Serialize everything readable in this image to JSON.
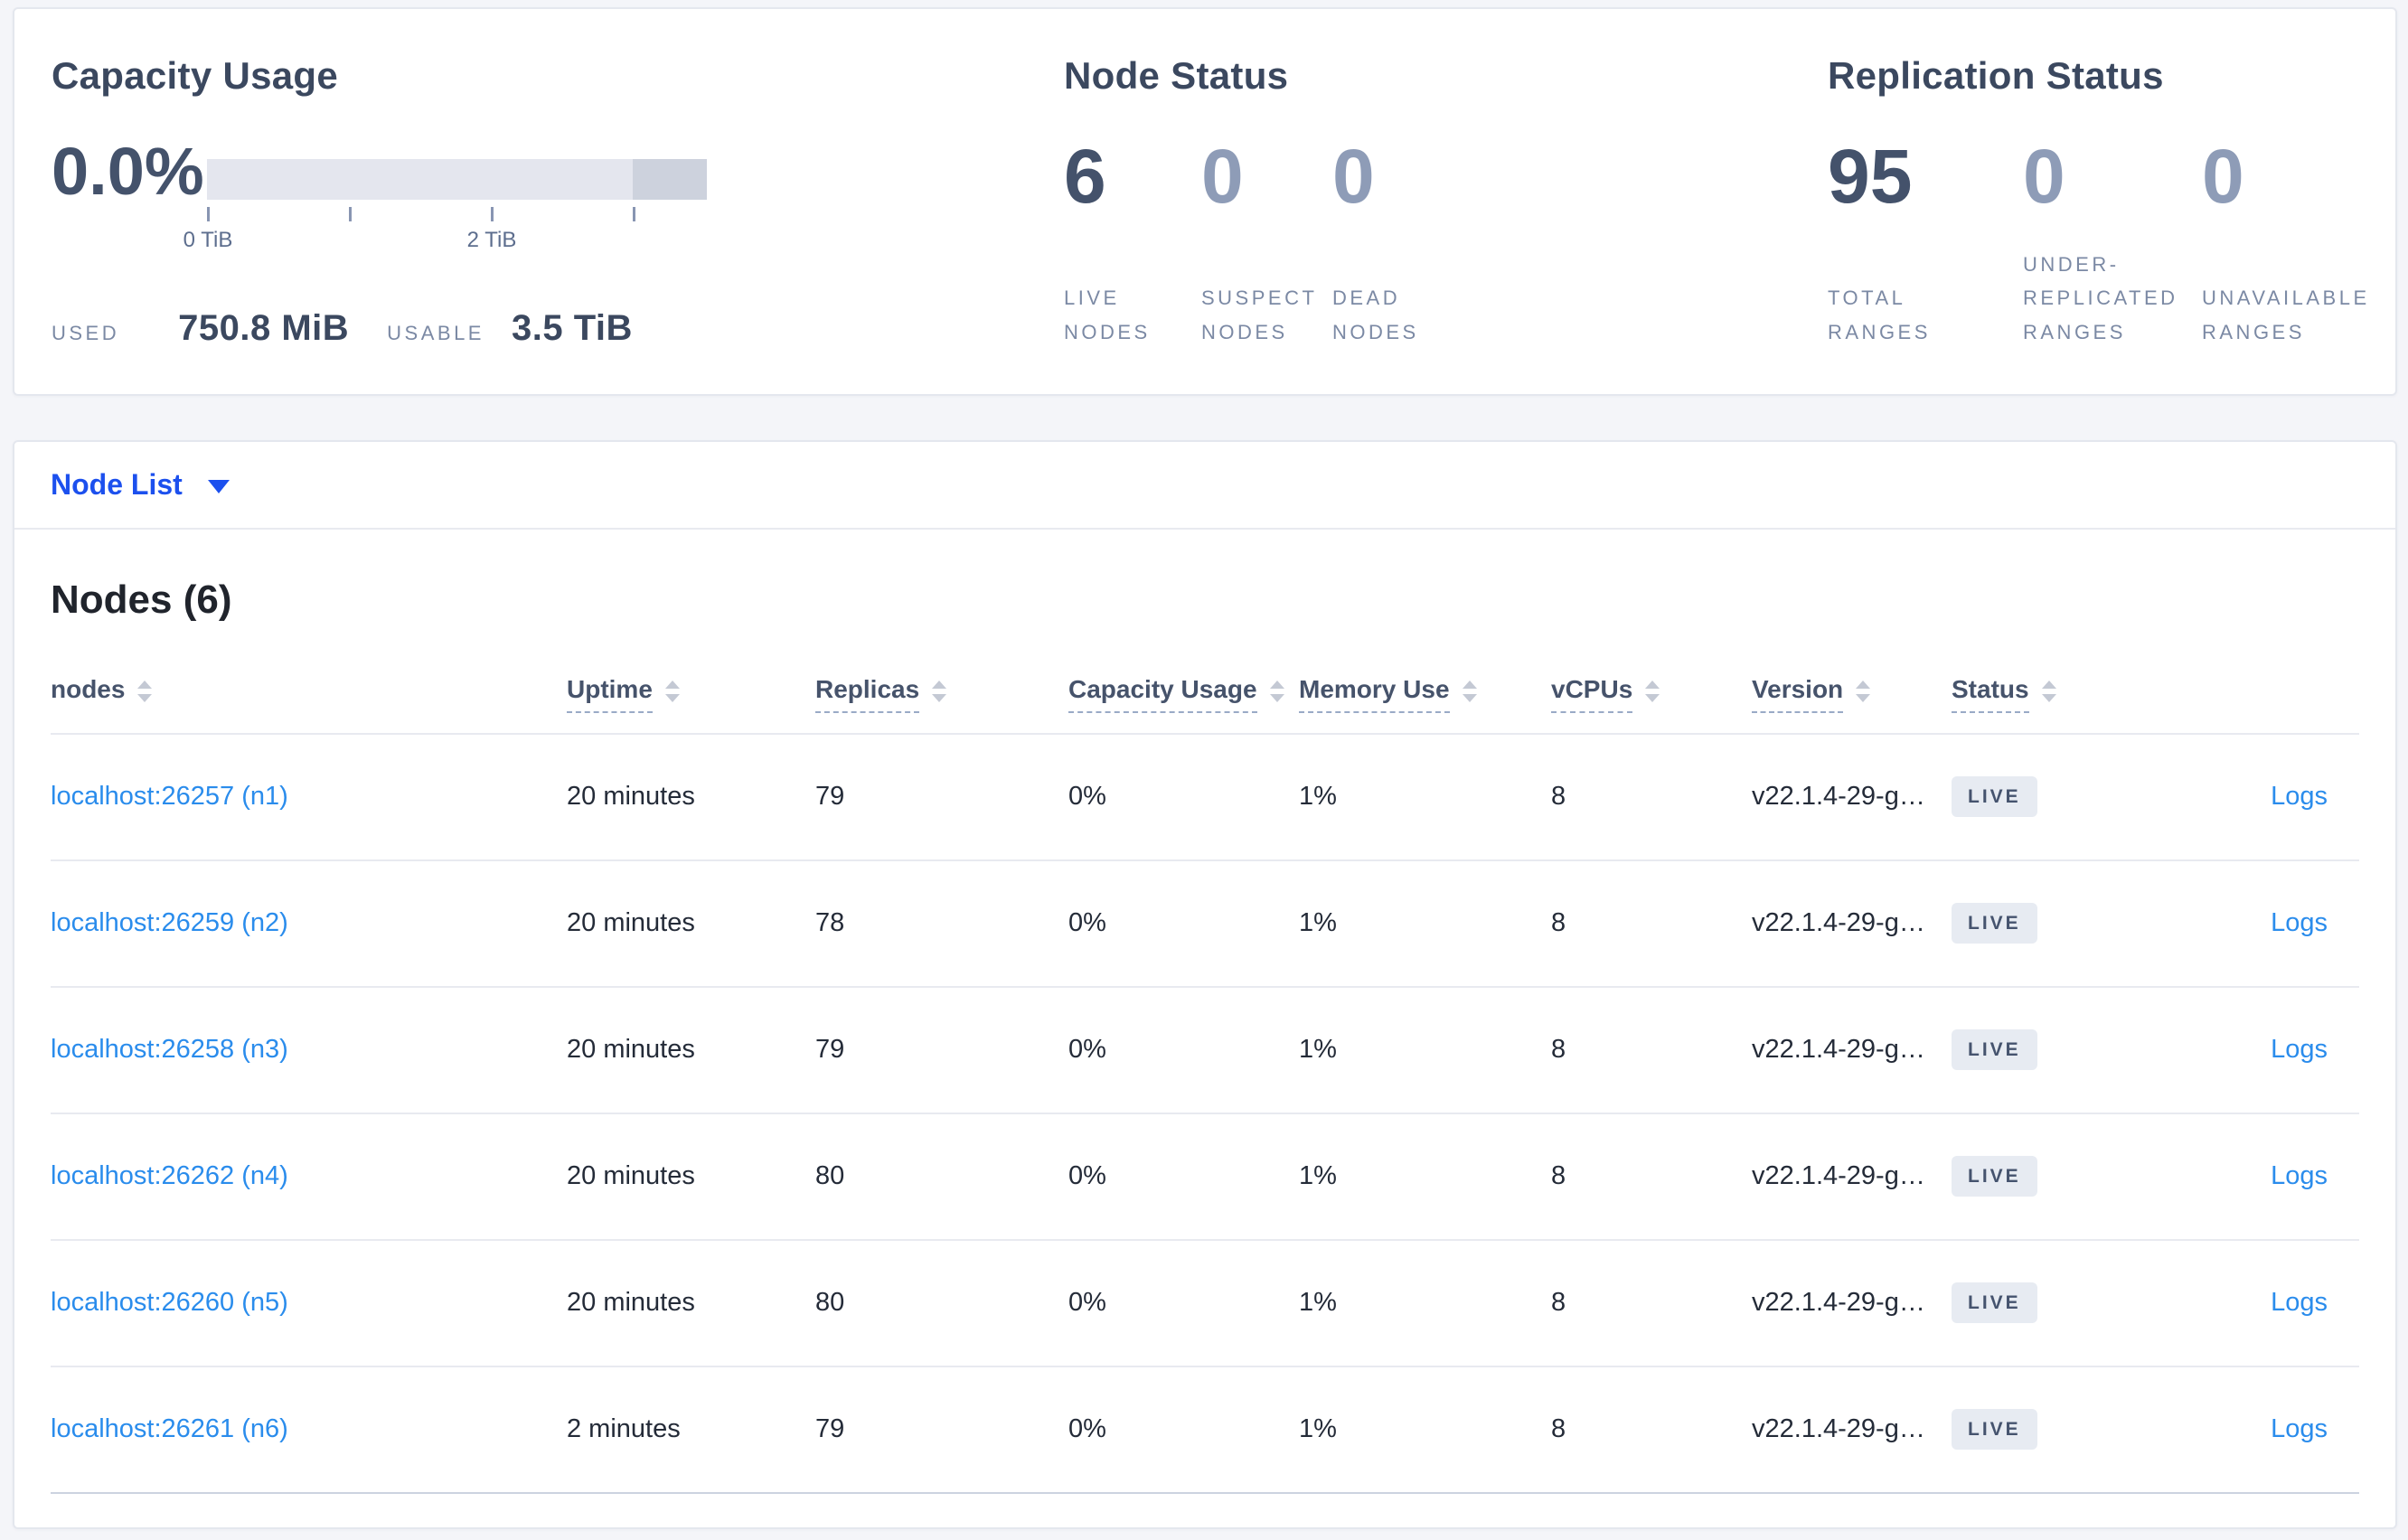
{
  "summary": {
    "capacity": {
      "title": "Capacity Usage",
      "percent": "0.0%",
      "axis_ticks": [
        "0 TiB",
        "2 TiB"
      ],
      "used_label": "USED",
      "used_value": "750.8 MiB",
      "usable_label": "USABLE",
      "usable_value": "3.5 TiB"
    },
    "node_status": {
      "title": "Node Status",
      "stats": [
        {
          "value": "6",
          "label": "LIVE NODES",
          "muted": false
        },
        {
          "value": "0",
          "label": "SUSPECT NODES",
          "muted": true
        },
        {
          "value": "0",
          "label": "DEAD NODES",
          "muted": true
        }
      ]
    },
    "replication": {
      "title": "Replication Status",
      "stats": [
        {
          "value": "95",
          "label": "TOTAL RANGES",
          "muted": false
        },
        {
          "value": "0",
          "label": "UNDER-REPLICATED RANGES",
          "muted": true
        },
        {
          "value": "0",
          "label": "UNAVAILABLE RANGES",
          "muted": true
        }
      ]
    }
  },
  "node_list": {
    "label": "Node List"
  },
  "table": {
    "title": "Nodes (6)",
    "columns": [
      {
        "label": "nodes",
        "underline": false,
        "sortable": true
      },
      {
        "label": "Uptime",
        "underline": true,
        "sortable": true
      },
      {
        "label": "Replicas",
        "underline": true,
        "sortable": true
      },
      {
        "label": "Capacity Usage",
        "underline": true,
        "sortable": true
      },
      {
        "label": "Memory Use",
        "underline": true,
        "sortable": true
      },
      {
        "label": "vCPUs",
        "underline": true,
        "sortable": true
      },
      {
        "label": "Version",
        "underline": true,
        "sortable": true
      },
      {
        "label": "Status",
        "underline": true,
        "sortable": true
      },
      {
        "label": "",
        "underline": false,
        "sortable": false
      }
    ],
    "rows": [
      {
        "address": "localhost:26257 (n1)",
        "uptime": "20 minutes",
        "replicas": "79",
        "capacity": "0%",
        "memory": "1%",
        "vcpus": "8",
        "version": "v22.1.4-29-g…",
        "status": "LIVE",
        "logs": "Logs"
      },
      {
        "address": "localhost:26259 (n2)",
        "uptime": "20 minutes",
        "replicas": "78",
        "capacity": "0%",
        "memory": "1%",
        "vcpus": "8",
        "version": "v22.1.4-29-g…",
        "status": "LIVE",
        "logs": "Logs"
      },
      {
        "address": "localhost:26258 (n3)",
        "uptime": "20 minutes",
        "replicas": "79",
        "capacity": "0%",
        "memory": "1%",
        "vcpus": "8",
        "version": "v22.1.4-29-g…",
        "status": "LIVE",
        "logs": "Logs"
      },
      {
        "address": "localhost:26262 (n4)",
        "uptime": "20 minutes",
        "replicas": "80",
        "capacity": "0%",
        "memory": "1%",
        "vcpus": "8",
        "version": "v22.1.4-29-g…",
        "status": "LIVE",
        "logs": "Logs"
      },
      {
        "address": "localhost:26260 (n5)",
        "uptime": "20 minutes",
        "replicas": "80",
        "capacity": "0%",
        "memory": "1%",
        "vcpus": "8",
        "version": "v22.1.4-29-g…",
        "status": "LIVE",
        "logs": "Logs"
      },
      {
        "address": "localhost:26261 (n6)",
        "uptime": "2 minutes",
        "replicas": "79",
        "capacity": "0%",
        "memory": "1%",
        "vcpus": "8",
        "version": "v22.1.4-29-g…",
        "status": "LIVE",
        "logs": "Logs"
      }
    ]
  },
  "colors": {
    "page_bg": "#f4f5f9",
    "card_border": "#e4e7ee",
    "heading": "#3b485f",
    "number": "#44526b",
    "muted_number": "#8e9cb7",
    "stat_label": "#7b89a4",
    "header_text": "#46536b",
    "cell_text": "#242b38",
    "underline": "#9aaac6",
    "sort_icon": "#c4c9d4",
    "link_blue": "#2a8cec",
    "accent_blue": "#1c50ee",
    "divider": "#e8eaf0",
    "divider_strong": "#ccd3e0",
    "badge_bg": "#e7ebf2",
    "badge_text": "#45536e",
    "bar_fill": "#e4e6ee",
    "bar_extra": "#cdd2dd",
    "tick": "#8895b2",
    "tick_label": "#5d6e8e"
  }
}
